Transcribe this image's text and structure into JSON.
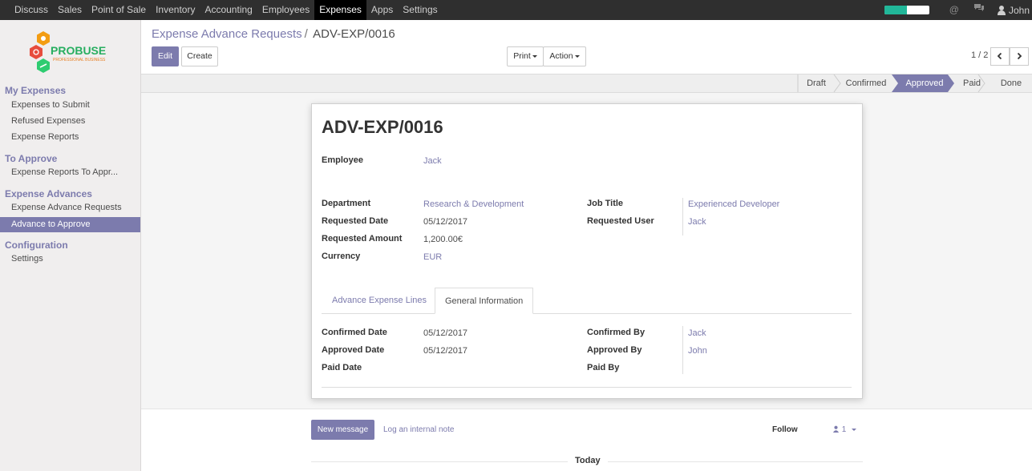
{
  "topbar": {
    "nav": [
      "Discuss",
      "Sales",
      "Point of Sale",
      "Inventory",
      "Accounting",
      "Employees",
      "Expenses",
      "Apps",
      "Settings"
    ],
    "active": "Expenses",
    "user": "John",
    "progress_fraction": 0.5
  },
  "sidebar": {
    "logo": {
      "brand": "PROBUSE",
      "tagline": "PROFESSIONAL BUSINESS"
    },
    "sections": [
      {
        "title": "My Expenses",
        "items": [
          "Expenses to Submit",
          "Refused Expenses",
          "Expense Reports"
        ]
      },
      {
        "title": "To Approve",
        "items": [
          "Expense Reports To Appr..."
        ]
      },
      {
        "title": "Expense Advances",
        "items": [
          "Expense Advance Requests",
          "Advance to Approve"
        ]
      },
      {
        "title": "Configuration",
        "items": [
          "Settings"
        ]
      }
    ],
    "active_item": "Advance to Approve"
  },
  "breadcrumb": {
    "parent": "Expense Advance Requests",
    "separator": "/",
    "current": "ADV-EXP/0016"
  },
  "buttons": {
    "edit": "Edit",
    "create": "Create",
    "print": "Print",
    "action": "Action"
  },
  "pager": {
    "value": "1 / 2"
  },
  "statusbar": {
    "stages": [
      "Draft",
      "Confirmed",
      "Approved",
      "Paid",
      "Done"
    ],
    "current": "Approved"
  },
  "record": {
    "title": "ADV-EXP/0016",
    "employee": {
      "label": "Employee",
      "value": "Jack"
    },
    "department": {
      "label": "Department",
      "value": "Research & Development"
    },
    "requested_date": {
      "label": "Requested Date",
      "value": "05/12/2017"
    },
    "requested_amount": {
      "label": "Requested Amount",
      "value": "1,200.00€"
    },
    "currency": {
      "label": "Currency",
      "value": "EUR"
    },
    "job_title": {
      "label": "Job Title",
      "value": "Experienced Developer"
    },
    "requested_user": {
      "label": "Requested User",
      "value": "Jack"
    }
  },
  "tabs": {
    "lines": "Advance Expense Lines",
    "general": "General Information",
    "active": "General Information"
  },
  "general": {
    "confirmed_date": {
      "label": "Confirmed Date",
      "value": "05/12/2017"
    },
    "approved_date": {
      "label": "Approved Date",
      "value": "05/12/2017"
    },
    "paid_date": {
      "label": "Paid Date",
      "value": ""
    },
    "confirmed_by": {
      "label": "Confirmed By",
      "value": "Jack"
    },
    "approved_by": {
      "label": "Approved By",
      "value": "John"
    },
    "paid_by": {
      "label": "Paid By",
      "value": ""
    }
  },
  "chatter": {
    "new_message": "New message",
    "log_note": "Log an internal note",
    "follow": "Follow",
    "followers": "1",
    "today": "Today"
  },
  "colors": {
    "accent": "#7c7bad",
    "topbar": "#2f2f2f",
    "progress": "#21b799"
  }
}
